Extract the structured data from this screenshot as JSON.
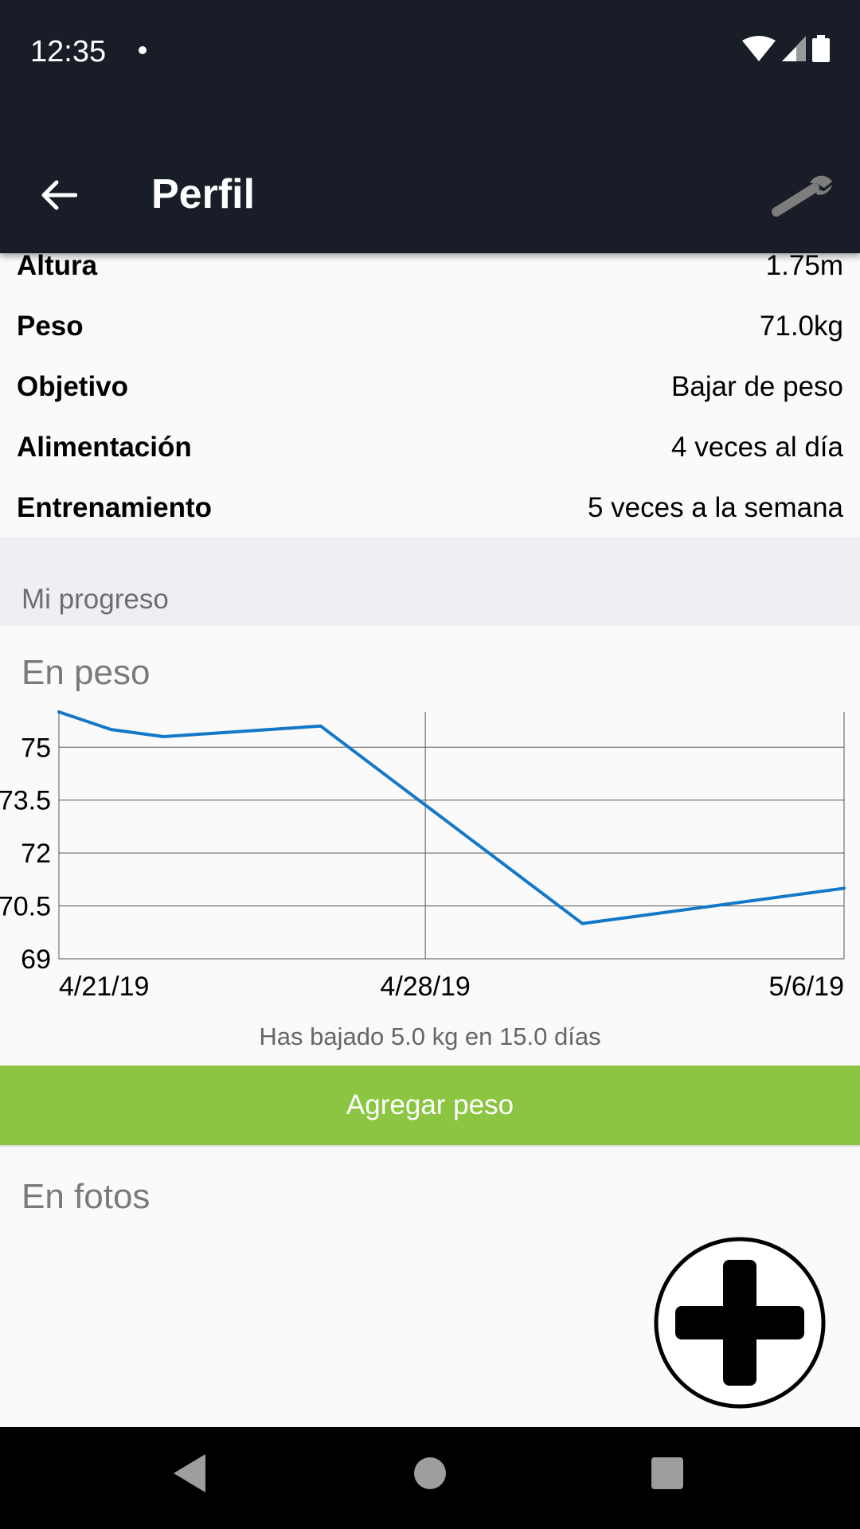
{
  "status_bar": {
    "time": "12:35"
  },
  "app_bar": {
    "title": "Perfil"
  },
  "profile": [
    {
      "label": "Altura",
      "value": "1.75m"
    },
    {
      "label": "Peso",
      "value": "71.0kg"
    },
    {
      "label": "Objetivo",
      "value": "Bajar de peso"
    },
    {
      "label": "Alimentación",
      "value": "4 veces al día"
    },
    {
      "label": "Entrenamiento",
      "value": "5 veces a la semana"
    }
  ],
  "progress_section": {
    "header": "Mi progreso"
  },
  "weight_card": {
    "title": "En peso",
    "summary": "Has bajado 5.0 kg en 15.0 días",
    "add_button": "Agregar peso"
  },
  "photos_card": {
    "title": "En fotos"
  },
  "colors": {
    "app_bar": "#181d27",
    "accent_green": "#8bc541",
    "line": "#1478c8"
  },
  "chart_data": {
    "type": "line",
    "xlabel": "",
    "ylabel": "",
    "x_tick_labels": [
      "4/21/19",
      "4/28/19",
      "5/6/19"
    ],
    "y_tick_labels": [
      "69",
      "70.5",
      "72",
      "73.5",
      "75"
    ],
    "ylim": [
      69,
      76
    ],
    "x_day_range": [
      "4/21/19",
      "5/6/19"
    ],
    "series": [
      {
        "x": [
          "4/21/19",
          "4/22/19",
          "4/23/19",
          "4/26/19",
          "5/1/19",
          "5/6/19"
        ],
        "y": [
          76.0,
          75.5,
          75.3,
          75.6,
          70.0,
          71.0
        ]
      }
    ],
    "grid": true
  }
}
